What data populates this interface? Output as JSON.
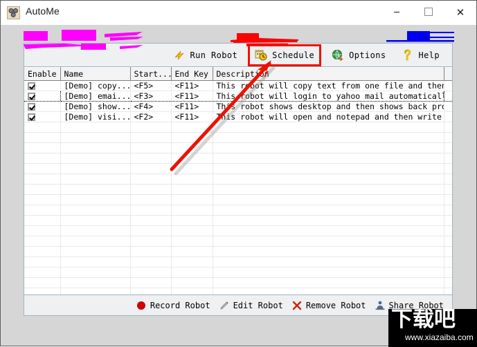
{
  "window": {
    "title": "AutoMe",
    "icon": "autome-app-icon",
    "controls": {
      "minimize": "—",
      "maximize": "☐",
      "close": "✕"
    }
  },
  "toolbar": {
    "items": [
      {
        "label": "Run Robot",
        "icon": "lightning-bolt-icon",
        "highlighted": false
      },
      {
        "label": "Schedule",
        "icon": "clock-calendar-icon",
        "highlighted": true
      },
      {
        "label": "Options",
        "icon": "globe-tools-icon",
        "highlighted": false
      },
      {
        "label": "Help",
        "icon": "question-mark-icon",
        "highlighted": false
      }
    ]
  },
  "list": {
    "columns": [
      "Enable",
      "Name",
      "Start...",
      "End Key",
      "Description",
      ""
    ],
    "rows": [
      {
        "enabled": true,
        "name": "[Demo] copy...",
        "start_key": "<F5>",
        "end_key": "<F11>",
        "description": "This robot will copy text from one file and then p...",
        "focused": false
      },
      {
        "enabled": true,
        "name": "[Demo] emai...",
        "start_key": "<F3>",
        "end_key": "<F11>",
        "description": "This robot will login to yahoo mail automatically",
        "focused": true
      },
      {
        "enabled": true,
        "name": "[Demo] show...",
        "start_key": "<F4>",
        "end_key": "<F11>",
        "description": "This robot shows desktop and then shows back progr...",
        "focused": false
      },
      {
        "enabled": true,
        "name": "[Demo] visi...",
        "start_key": "<F2>",
        "end_key": "<F11>",
        "description": "This robot will open and notepad and then write",
        "focused": false
      }
    ],
    "empty_row_count": 20
  },
  "footer": {
    "items": [
      {
        "label": "Record Robot",
        "icon": "red-circle-record-icon"
      },
      {
        "label": "Edit Robot",
        "icon": "pencil-icon"
      },
      {
        "label": "Remove Robot",
        "icon": "red-x-icon"
      },
      {
        "label": "Share Robot",
        "icon": "share-person-icon"
      }
    ]
  },
  "watermark": {
    "text_cn": "下载吧",
    "url": "www.xiazaiba.com"
  },
  "annotations": {
    "arrow_color": "#ee1100",
    "highlight_box_color": "#f01000",
    "scribble_colors": [
      "#ff00ff",
      "#fe0000",
      "#0000ee"
    ]
  }
}
